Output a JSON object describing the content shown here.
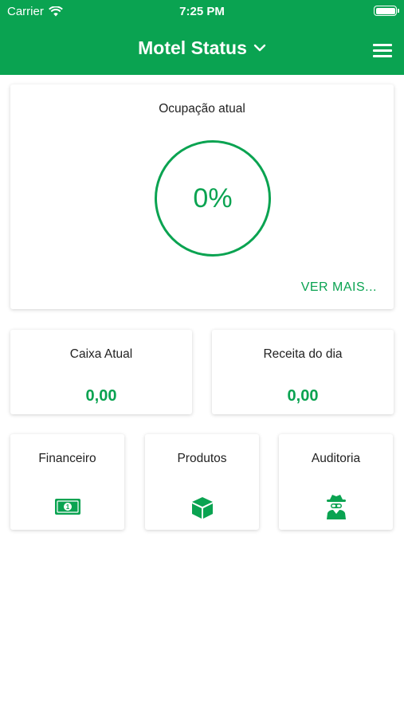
{
  "status_bar": {
    "carrier": "Carrier",
    "time": "7:25 PM"
  },
  "header": {
    "title": "Motel Status"
  },
  "occupancy": {
    "label": "Ocupação atual",
    "value": "0%",
    "see_more": "VER MAIS..."
  },
  "cash": {
    "label": "Caixa Atual",
    "value": "0,00"
  },
  "revenue": {
    "label": "Receita do dia",
    "value": "0,00"
  },
  "shortcuts": [
    {
      "label": "Financeiro",
      "icon": "money-bill-icon"
    },
    {
      "label": "Produtos",
      "icon": "box-icon"
    },
    {
      "label": "Auditoria",
      "icon": "spy-icon"
    }
  ],
  "colors": {
    "accent": "#0aa351",
    "background": "#ffffff"
  }
}
